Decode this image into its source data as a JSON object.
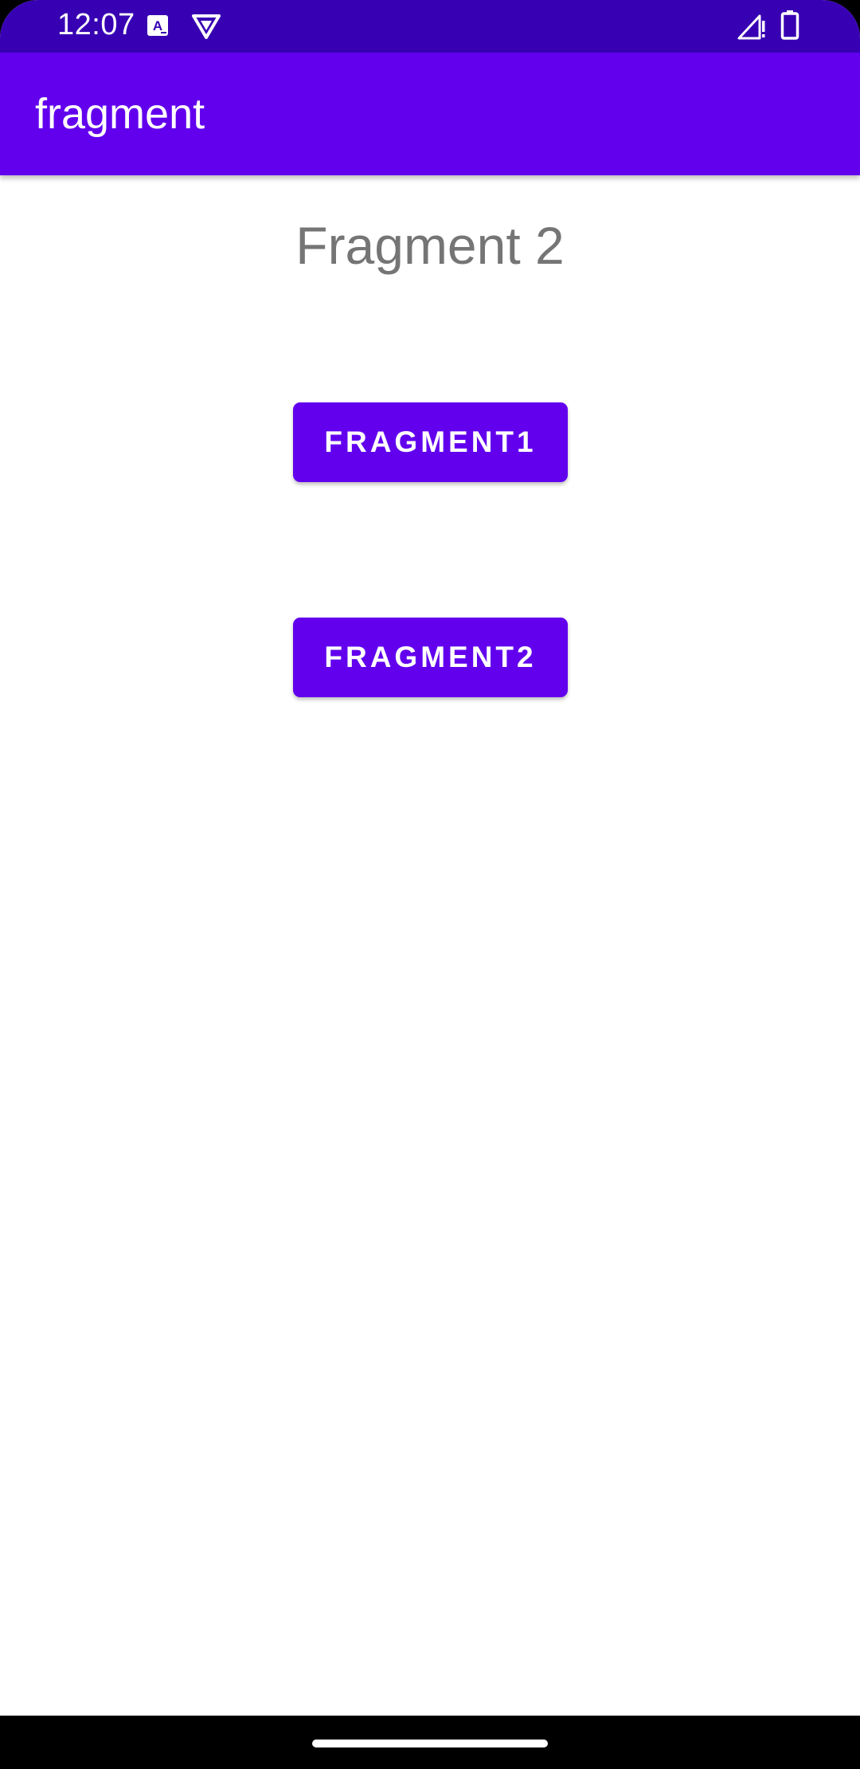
{
  "status_bar": {
    "time": "12:07",
    "icons": [
      "text-a-icon",
      "vpn-shield-icon",
      "signal-no-data-icon",
      "battery-icon"
    ],
    "color": "#3700b3"
  },
  "app_bar": {
    "title": "fragment",
    "color": "#6200ee"
  },
  "main": {
    "fragment_title": "Fragment 2",
    "buttons": [
      {
        "label": "FRAGMENT1"
      },
      {
        "label": "FRAGMENT2"
      }
    ]
  },
  "colors": {
    "accent": "#6200ee",
    "primary_dark": "#3700b3",
    "text_gray": "#757575"
  }
}
